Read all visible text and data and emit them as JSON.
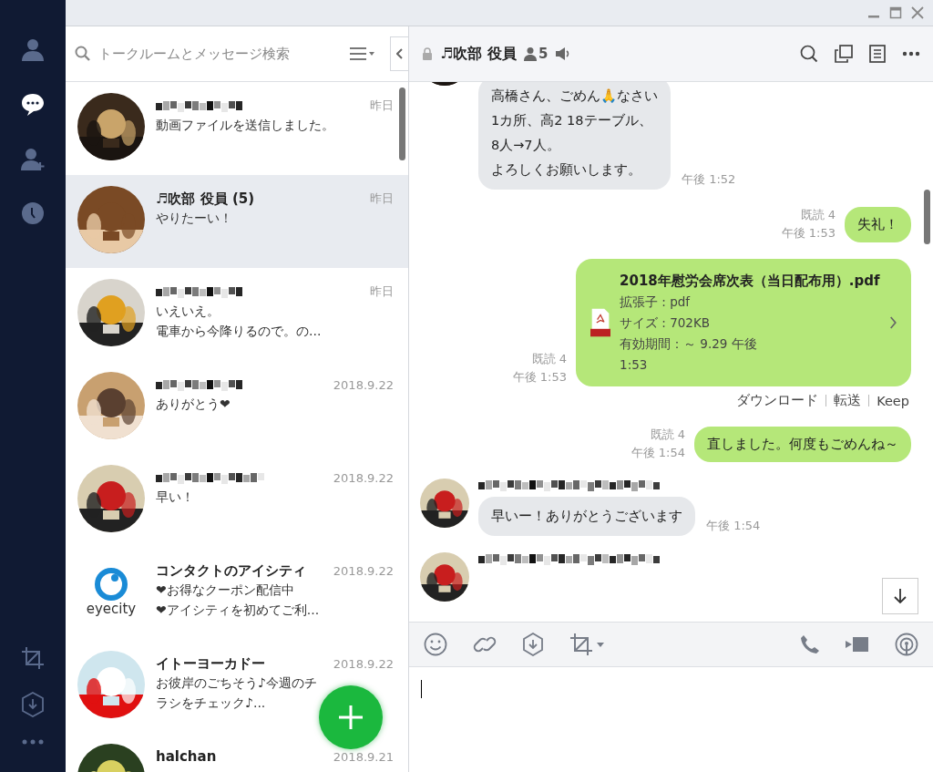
{
  "nav": [
    {
      "kind": "friends",
      "selected": false
    },
    {
      "kind": "chats",
      "selected": true
    },
    {
      "kind": "add-friend",
      "selected": false
    },
    {
      "kind": "timeline",
      "selected": false
    }
  ],
  "search": {
    "placeholder": "トークルームとメッセージ検索"
  },
  "chats": [
    {
      "time": "昨日",
      "preview": [
        "動画ファイルを送信しました。"
      ],
      "selected": false,
      "avatar": {
        "kind": "picture"
      }
    },
    {
      "name": "♬吹部 役員 (5)",
      "time": "昨日",
      "preview": [
        "やりたーい！"
      ],
      "selected": true,
      "avatar": {
        "kind": "picture"
      }
    },
    {
      "time": "昨日",
      "preview": [
        "いえいえ。",
        "電車から今降りるので。の..."
      ],
      "selected": false,
      "avatar": {
        "kind": "picture"
      }
    },
    {
      "time": "2018.9.22",
      "preview": [
        "ありがとう❤"
      ],
      "selected": false,
      "avatar": {
        "kind": "picture"
      }
    },
    {
      "time": "2018.9.22",
      "preview": [
        "早い！"
      ],
      "selected": false,
      "avatar": {
        "kind": "picture"
      }
    },
    {
      "name": "コンタクトのアイシティ",
      "time": "2018.9.22",
      "preview": [
        "❤お得なクーポン配信中",
        "❤アイシティを初めてご利..."
      ],
      "selected": false,
      "avatar": {
        "kind": "logo",
        "text": "eyecity"
      }
    },
    {
      "name": "イトーヨーカドー",
      "time": "2018.9.22",
      "preview": [
        "お彼岸のごちそう♪今週のチ",
        "ラシをチェック♪..."
      ],
      "selected": false,
      "avatar": {
        "kind": "picture"
      }
    },
    {
      "name": "halchan",
      "time": "2018.9.21",
      "selected": false,
      "avatar": {
        "kind": "picture"
      }
    }
  ],
  "room": {
    "title": "♬吹部 役員",
    "members": "5"
  },
  "messages": [
    {
      "kind": "in",
      "lines": [
        "高橋さん、ごめん🙏なさい",
        "1カ所、高2 18テーブル、",
        "8人→7人。",
        "よろしくお願いします。"
      ],
      "time": "午後 1:52"
    },
    {
      "kind": "out",
      "lines": [
        "失礼！"
      ],
      "read": "既読 4",
      "time": "午後 1:53"
    },
    {
      "kind": "file",
      "file_name": "2018年慰労会席次表（当日配布用）.pdf",
      "lines": [
        "拡張子 : pdf",
        "サイズ : 702KB",
        "有効期間：～ 9.29 午後",
        "1:53"
      ],
      "read": "既読 4",
      "time": "午後 1:53",
      "actions": [
        "ダウンロード",
        "転送",
        "Keep"
      ]
    },
    {
      "kind": "out",
      "lines": [
        "直しました。何度もごめんね～"
      ],
      "read": "既読 4",
      "time": "午後 1:54"
    },
    {
      "kind": "in",
      "lines": [
        "早いー！ありがとうございます"
      ],
      "time": "午後 1:54"
    },
    {
      "kind": "in"
    }
  ]
}
